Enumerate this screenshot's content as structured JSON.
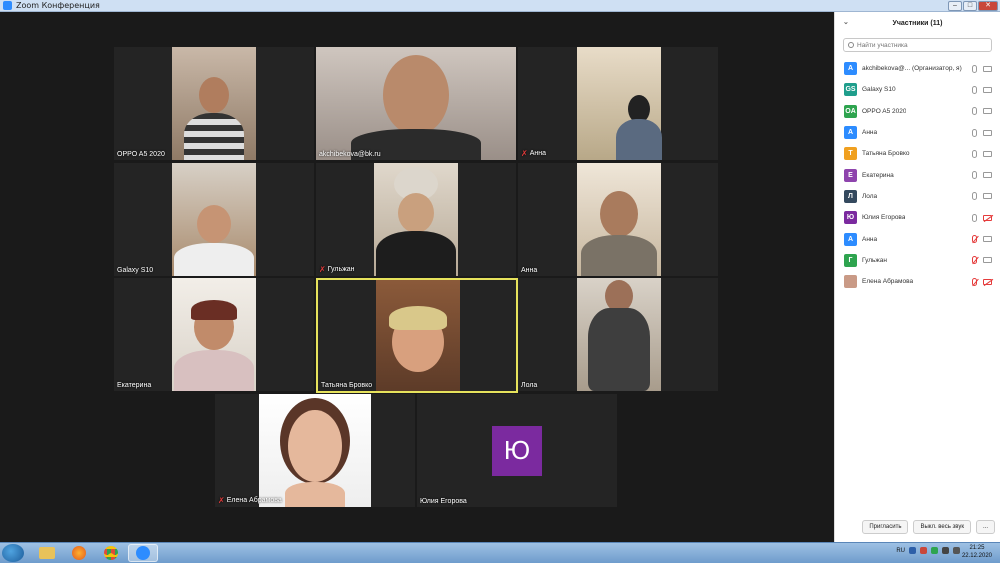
{
  "window": {
    "title": "Zoom Конференция"
  },
  "tiles": [
    {
      "name": "OPPO A5 2020",
      "muted": false
    },
    {
      "name": "akchibekova@bk.ru",
      "muted": false
    },
    {
      "name": "Анна",
      "muted": true
    },
    {
      "name": "Galaxy S10",
      "muted": false
    },
    {
      "name": "Гульжан",
      "muted": true
    },
    {
      "name": "Анна",
      "muted": false
    },
    {
      "name": "Екатерина",
      "muted": false
    },
    {
      "name": "Татьяна Бровко",
      "muted": false
    },
    {
      "name": "Лола",
      "muted": false
    },
    {
      "name": "Елена Абрамова",
      "muted": true
    },
    {
      "name": "Юлия Егорова",
      "muted": false,
      "avatar_letter": "Ю"
    }
  ],
  "sidebar": {
    "title": "Участники (11)",
    "search_placeholder": "Найти участника",
    "participants": [
      {
        "initials": "A",
        "name": "akchibekova@... (Организатор, я)",
        "color": "#2d8cff",
        "mic": "on",
        "cam": "on"
      },
      {
        "initials": "GS",
        "name": "Galaxy S10",
        "color": "#1f9e8c",
        "mic": "on",
        "cam": "on"
      },
      {
        "initials": "OA",
        "name": "OPPO A5 2020",
        "color": "#2ea44f",
        "mic": "on",
        "cam": "on"
      },
      {
        "initials": "А",
        "name": "Анна",
        "color": "#2d8cff",
        "mic": "on",
        "cam": "on"
      },
      {
        "initials": "Т",
        "name": "Татьяна Бровко",
        "color": "#f0a020",
        "mic": "on",
        "cam": "on"
      },
      {
        "initials": "Е",
        "name": "Екатерина",
        "color": "#8e44ad",
        "mic": "on",
        "cam": "on"
      },
      {
        "initials": "Л",
        "name": "Лола",
        "color": "#34495e",
        "mic": "on",
        "cam": "on"
      },
      {
        "initials": "Ю",
        "name": "Юлия Егорова",
        "color": "#7b2a9f",
        "mic": "on",
        "cam": "off"
      },
      {
        "initials": "А",
        "name": "Анна",
        "color": "#2d8cff",
        "mic": "muted",
        "cam": "on"
      },
      {
        "initials": "Г",
        "name": "Гульжан",
        "color": "#2ea44f",
        "mic": "muted",
        "cam": "on"
      },
      {
        "initials": "",
        "name": "Елена Абрамова",
        "color": "#c99a86",
        "mic": "muted",
        "cam": "off"
      }
    ],
    "invite_label": "Пригласить",
    "mute_all_label": "Выкл. весь звук",
    "more_label": "..."
  },
  "taskbar": {
    "language": "RU",
    "time": "21:25",
    "date": "22.12.2020"
  }
}
